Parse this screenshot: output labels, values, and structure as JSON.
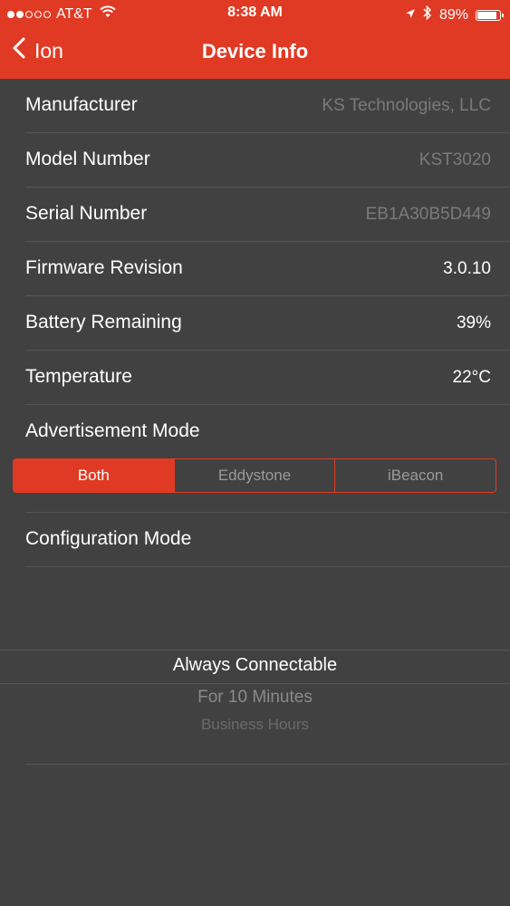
{
  "status_bar": {
    "carrier": "AT&T",
    "time": "8:38 AM",
    "battery_percent": "89%",
    "signal_dots_filled": 2,
    "signal_dots_total": 5
  },
  "nav": {
    "back_label": "Ion",
    "title": "Device Info"
  },
  "info_rows": [
    {
      "label": "Manufacturer",
      "value": "KS Technologies, LLC"
    },
    {
      "label": "Model Number",
      "value": "KST3020"
    },
    {
      "label": "Serial Number",
      "value": "EB1A30B5D449"
    },
    {
      "label": "Firmware Revision",
      "value": "3.0.10"
    },
    {
      "label": "Battery Remaining",
      "value": "39%"
    },
    {
      "label": "Temperature",
      "value": "22°C"
    }
  ],
  "advertisement": {
    "label": "Advertisement Mode",
    "options": [
      "Both",
      "Eddystone",
      "iBeacon"
    ],
    "selected": "Both"
  },
  "configuration": {
    "label": "Configuration Mode",
    "picker_options": [
      "Always Connectable",
      "For 10 Minutes",
      "Business Hours"
    ],
    "selected": "Always Connectable"
  },
  "colors": {
    "accent": "#e03a24",
    "background": "#414141",
    "separator": "#555555",
    "muted_text": "#7a7a7a"
  }
}
